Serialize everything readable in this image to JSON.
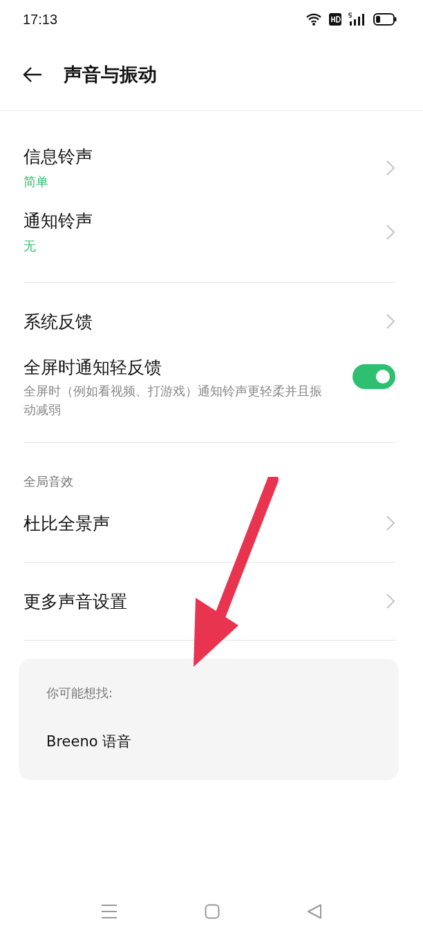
{
  "status_bar": {
    "time": "17:13"
  },
  "header": {
    "title": "声音与振动"
  },
  "sections": [
    {
      "items": [
        {
          "kind": "nav",
          "title": "信息铃声",
          "value": "简单"
        },
        {
          "kind": "nav",
          "title": "通知铃声",
          "value": "无"
        }
      ]
    },
    {
      "items": [
        {
          "kind": "nav",
          "title": "系统反馈"
        },
        {
          "kind": "toggle",
          "title": "全屏时通知轻反馈",
          "description": "全屏时（例如看视频、打游戏）通知铃声更轻柔并且振动减弱",
          "on": true
        }
      ]
    },
    {
      "label": "全局音效",
      "items": [
        {
          "kind": "nav",
          "title": "杜比全景声"
        }
      ]
    },
    {
      "items": [
        {
          "kind": "nav",
          "title": "更多声音设置"
        }
      ]
    }
  ],
  "suggestions": {
    "label": "你可能想找:",
    "items": [
      "Breeno 语音"
    ]
  }
}
